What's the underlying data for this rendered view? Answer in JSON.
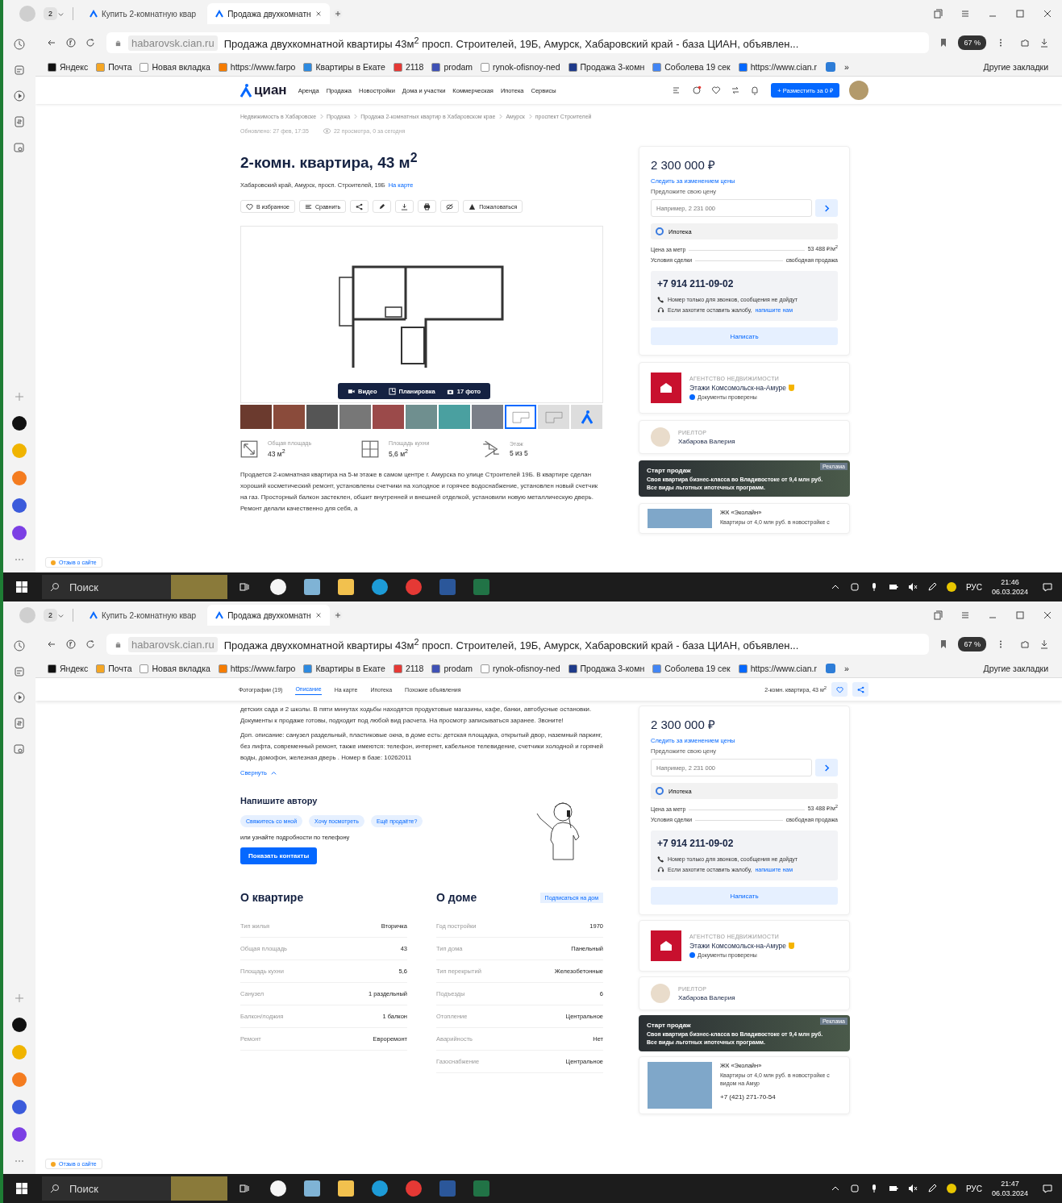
{
  "screens": [
    {
      "browser": {
        "profile_count": "2",
        "tabs": [
          {
            "label": "Купить 2-комнатную квар",
            "selected": false
          },
          {
            "label": "Продажа двухкомнатн",
            "selected": true
          }
        ],
        "domain": "habarovsk.cian.ru",
        "page_title": "Продажа двухкомнатной квартиры 43м$^{2}$ просп. Строителей, 19Б, Амурск, Хабаровский край - база ЦИАН, объявлен...",
        "protect_badge": "67 %",
        "bookmarks": [
          "Яндекс",
          "Почта",
          "Новая вкладка",
          "https://www.farpo",
          "Квартиры в Екате",
          "2118",
          "prodam",
          "rynok-ofisnoy-ned",
          "Продажа 3-комн",
          "Соболева 19 сек",
          "https://www.cian.r"
        ],
        "overflow": "»",
        "other_bookmarks": "Другие закладки"
      },
      "sidebar": {
        "feedback": "Отзыв о сайте"
      },
      "page": {
        "kind": "listing_top",
        "header": {
          "logo": "циан",
          "nav": [
            "Аренда",
            "Продажа",
            "Новостройки",
            "Дома и участки",
            "Коммерческая",
            "Ипотека",
            "Сервисы"
          ],
          "post_button": "+ Разместить за 0 ₽"
        },
        "breadcrumbs": [
          "Недвижимость в Хабаровске",
          "Продажа",
          "Продажа 2-комнатных квартир в Хабаровском крае",
          "Амурск",
          "проспект Строителей"
        ],
        "updated": "Обновлено: 27 фев, 17:35",
        "views": "22 просмотра, 0 за сегодня",
        "title": "2-комн. квартира, 43 м$^{2}$",
        "address": "Хабаровский край, Амурск, просп. Строителей, 19Б",
        "map_link": "На карте",
        "actions": [
          {
            "kind": "favorite",
            "label": "В избранное"
          },
          {
            "kind": "compare",
            "label": "Сравнить"
          },
          {
            "kind": "share"
          },
          {
            "kind": "edit"
          },
          {
            "kind": "download"
          },
          {
            "kind": "print"
          },
          {
            "kind": "hide"
          },
          {
            "kind": "report",
            "label": "Пожаловаться"
          }
        ],
        "media_buttons": [
          {
            "kind": "video",
            "label": "Видео"
          },
          {
            "kind": "plan",
            "label": "Планировка"
          },
          {
            "kind": "photo",
            "label": "17 фото"
          }
        ],
        "thumbnails": [
          {
            "kind": "photo",
            "selected": false
          },
          {
            "kind": "photo",
            "selected": false
          },
          {
            "kind": "photo",
            "selected": false
          },
          {
            "kind": "photo",
            "selected": false
          },
          {
            "kind": "photo",
            "selected": false
          },
          {
            "kind": "photo",
            "selected": false
          },
          {
            "kind": "photo",
            "selected": false
          },
          {
            "kind": "photo",
            "selected": false
          },
          {
            "kind": "plan",
            "selected": true
          },
          {
            "kind": "plan",
            "selected": false
          },
          {
            "kind": "map",
            "selected": false
          }
        ],
        "facts": [
          {
            "kind": "area",
            "label": "Общая площадь",
            "value": "43 м$^{2}$"
          },
          {
            "kind": "kitchen",
            "label": "Площадь кухни",
            "value": "5,6 м$^{2}$"
          },
          {
            "kind": "floor",
            "label": "Этаж",
            "value": "5 из 5"
          }
        ],
        "description": [
          "Продается 2-комнатная квартира на 5-м этаже в самом центре г. Амурска по улице Строителей 19Б. В квартире сделан хороший косметический ремонт, установлены счетчики на холодное и горячее водоснабжение, установлен новый счетчик на газ. Просторный балкон застеклен, обшит внутренней и внешней отделкой, установили новую металлическую дверь. Ремонт делали качественно для себя, а"
        ],
        "aside": {
          "price": "2 300 000 ₽",
          "watch_link": "Следить за изменением цены",
          "offer_label": "Предложите свою цену",
          "offer_placeholder": "Например, 2 231 000",
          "mortgage": "Ипотека",
          "terms": [
            {
              "label": "Цена за метр",
              "value": "53 488 ₽/м$^{2}$"
            },
            {
              "label": "Условия сделки",
              "value": "свободная продажа"
            }
          ],
          "phone": "+7 914 211-09-02",
          "notes": [
            {
              "kind": "phone",
              "text": "Номер только для звонков, сообщения не дойдут"
            },
            {
              "kind": "complaint",
              "text": "Если захотите оставить жалобу,",
              "link": "напишите нам"
            }
          ],
          "write_button": "Написать",
          "agency": {
            "caption": "АГЕНТСТВО НЕДВИЖИМОСТИ",
            "name": "Этажи Комсомольск-на-Амуре",
            "verified": "Документы проверены"
          },
          "realtor": {
            "caption": "РИЕЛТОР",
            "name": "Хабарова Валерия"
          },
          "banner": {
            "title": "Старт продаж",
            "lines": [
              "Своя квартира бизнес-класса во Владивостоке от 9,4 млн руб.",
              "Все виды льготных ипотечных программ."
            ],
            "tag": "Реклама"
          },
          "complex": {
            "name": "ЖК «Эколайн»",
            "text": "Квартиры от 4,0 млн руб. в новостройке с"
          }
        }
      },
      "taskbar": {
        "search": "Поиск",
        "lang": "РУС",
        "time": "21:46",
        "date": "06.03.2024"
      }
    },
    {
      "browser": {
        "profile_count": "2",
        "tabs": [
          {
            "label": "Купить 2-комнатную квар",
            "selected": false
          },
          {
            "label": "Продажа двухкомнатн",
            "selected": true
          }
        ],
        "domain": "habarovsk.cian.ru",
        "page_title": "Продажа двухкомнатной квартиры 43м$^{2}$ просп. Строителей, 19Б, Амурск, Хабаровский край - база ЦИАН, объявлен...",
        "protect_badge": "67 %",
        "bookmarks": [
          "Яндекс",
          "Почта",
          "Новая вкладка",
          "https://www.farpo",
          "Квартиры в Екате",
          "2118",
          "prodam",
          "rynok-ofisnoy-ned",
          "Продажа 3-комн",
          "Соболева 19 сек",
          "https://www.cian.r"
        ],
        "overflow": "»",
        "other_bookmarks": "Другие закладки"
      },
      "sidebar": {
        "feedback": "Отзыв о сайте"
      },
      "page": {
        "kind": "listing_bottom",
        "sticky": {
          "tabs": [
            {
              "label": "Фотографии (19)",
              "selected": false
            },
            {
              "label": "Описание",
              "selected": true
            },
            {
              "label": "На карте",
              "selected": false
            },
            {
              "label": "Ипотека",
              "selected": false
            },
            {
              "label": "Похожие объявления",
              "selected": false
            }
          ],
          "title": "2-комн. квартира, 43 м$^{2}$"
        },
        "description": [
          "детских сада и 2 школы. В пяти минутах ходьбы находятся продуктовые магазины, кафе, банки, автобусные остановки. Документы к продаже готовы, подходит под любой вид расчета. На просмотр записываться заранее. Звоните!",
          "Доп. описание: санузел раздельный, пластиковые окна, в доме есть: детская площадка, открытый двор, наземный паркинг, без лифта, современный ремонт, также имеются: телефон, интернет, кабельное телевидение, счетчики холодной и горячей воды, домофон, железная дверь . Номер в базе: 10262011"
        ],
        "collapse": "Свернуть",
        "contact": {
          "title": "Напишите автору",
          "chips": [
            "Свяжитесь со мной",
            "Хочу посмотреть",
            "Ещё продаёте?"
          ],
          "hint": "или узнайте подробности по телефону",
          "button": "Показать контакты"
        },
        "flat": {
          "title": "О квартире",
          "rows": [
            {
              "label": "Тип жилья",
              "value": "Вторичка"
            },
            {
              "label": "Общая площадь",
              "value": "43"
            },
            {
              "label": "Площадь кухни",
              "value": "5,6"
            },
            {
              "label": "Санузел",
              "value": "1 раздельный"
            },
            {
              "label": "Балкон/лоджия",
              "value": "1 балкон"
            },
            {
              "label": "Ремонт",
              "value": "Евроремонт"
            }
          ]
        },
        "house": {
          "title": "О доме",
          "subscribe": "Подписаться на дом",
          "rows": [
            {
              "label": "Год постройки",
              "value": "1970"
            },
            {
              "label": "Тип дома",
              "value": "Панельный"
            },
            {
              "label": "Тип перекрытий",
              "value": "Железобетонные"
            },
            {
              "label": "Подъезды",
              "value": "6"
            },
            {
              "label": "Отопление",
              "value": "Центральное"
            },
            {
              "label": "Аварийность",
              "value": "Нет"
            },
            {
              "label": "Газоснабжение",
              "value": "Центральное"
            }
          ]
        },
        "aside": {
          "price": "2 300 000 ₽",
          "watch_link": "Следить за изменением цены",
          "offer_label": "Предложите свою цену",
          "offer_placeholder": "Например, 2 231 000",
          "mortgage": "Ипотека",
          "terms": [
            {
              "label": "Цена за метр",
              "value": "53 488 ₽/м$^{2}$"
            },
            {
              "label": "Условия сделки",
              "value": "свободная продажа"
            }
          ],
          "phone": "+7 914 211-09-02",
          "notes": [
            {
              "kind": "phone",
              "text": "Номер только для звонков, сообщения не дойдут"
            },
            {
              "kind": "complaint",
              "text": "Если захотите оставить жалобу,",
              "link": "напишите нам"
            }
          ],
          "write_button": "Написать",
          "agency": {
            "caption": "АГЕНТСТВО НЕДВИЖИМОСТИ",
            "name": "Этажи Комсомольск-на-Амуре",
            "verified": "Документы проверены"
          },
          "realtor": {
            "caption": "РИЕЛТОР",
            "name": "Хабарова Валерия"
          },
          "banner": {
            "title": "Старт продаж",
            "lines": [
              "Своя квартира бизнес-класса во Владивостоке от 9,4 млн руб.",
              "Все виды льготных ипотечных программ."
            ],
            "tag": "Реклама"
          },
          "complex": {
            "name": "ЖК «Эколайн»",
            "text": "Квартиры от 4,0 млн руб. в новостройке с видом на Амур",
            "phone": "+7 (421) 271-70-54"
          }
        }
      },
      "taskbar": {
        "search": "Поиск",
        "lang": "РУС",
        "time": "21:47",
        "date": "06.03.2024"
      }
    }
  ]
}
